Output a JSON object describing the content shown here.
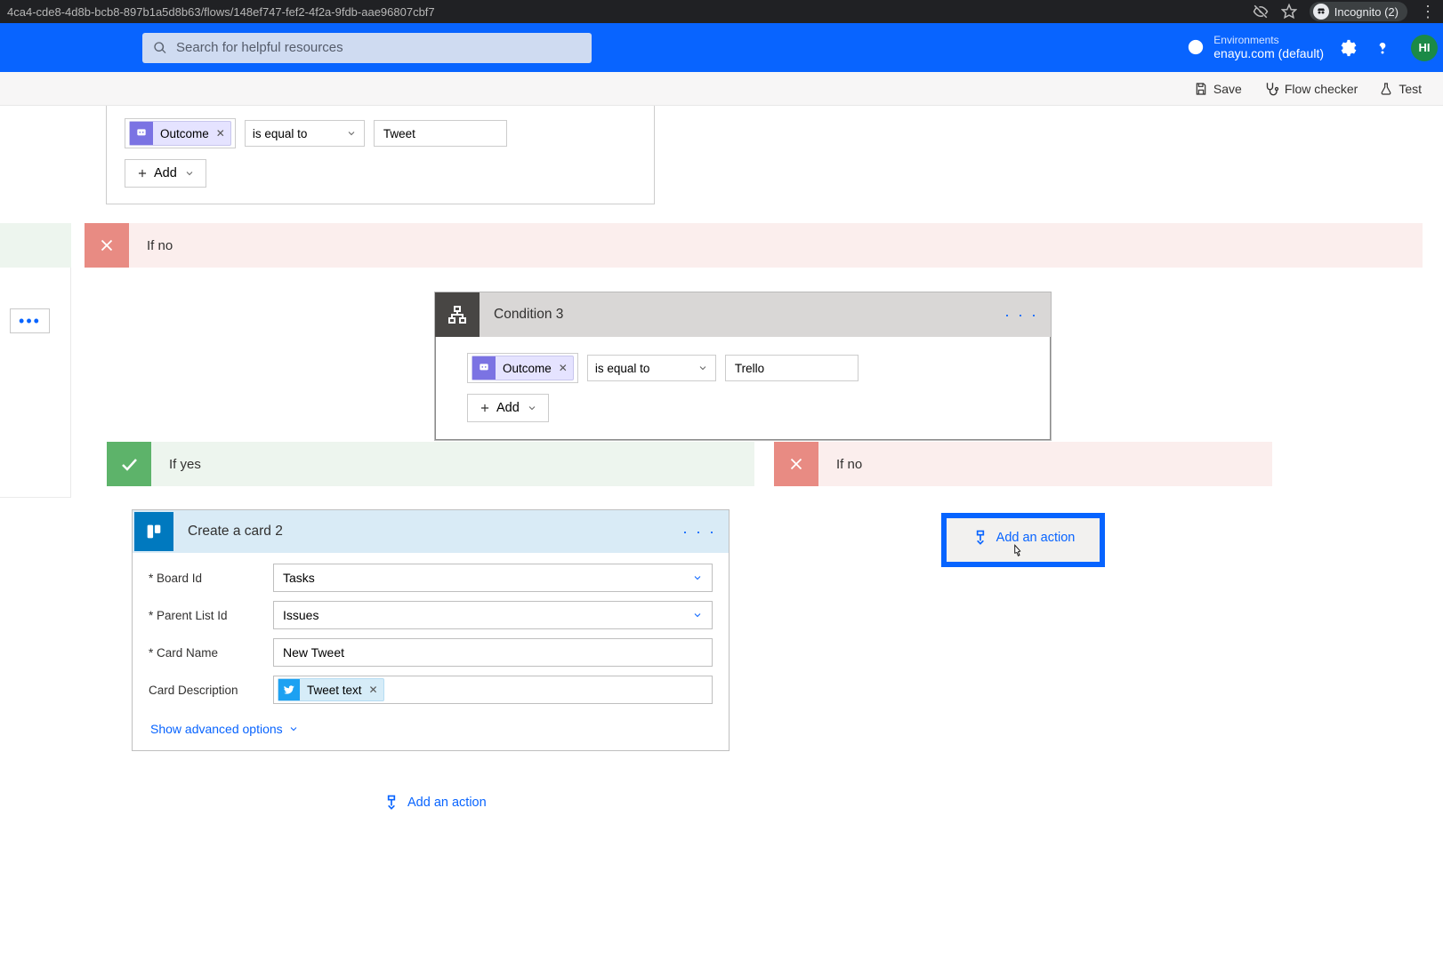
{
  "browser": {
    "url": "4ca4-cde8-4d8b-bcb8-897b1a5d8b63/flows/148ef747-fef2-4f2a-9fdb-aae96807cbf7",
    "incognito_label": "Incognito (2)"
  },
  "header": {
    "search_placeholder": "Search for helpful resources",
    "env_label": "Environments",
    "env_value": "enayu.com (default)",
    "avatar_initials": "HI"
  },
  "toolbar": {
    "save": "Save",
    "flow_checker": "Flow checker",
    "test": "Test"
  },
  "condition_top": {
    "token_label": "Outcome",
    "operator": "is equal to",
    "value": "Tweet",
    "add_label": "Add"
  },
  "branch_labels": {
    "if_no": "If no",
    "if_yes": "If yes"
  },
  "condition3": {
    "title": "Condition 3",
    "token_label": "Outcome",
    "operator": "is equal to",
    "value": "Trello",
    "add_label": "Add"
  },
  "trello_action": {
    "title": "Create a card 2",
    "fields": {
      "board_id": {
        "label": "* Board Id",
        "value": "Tasks"
      },
      "parent_list_id": {
        "label": "* Parent List Id",
        "value": "Issues"
      },
      "card_name": {
        "label": "* Card Name",
        "value": "New Tweet"
      },
      "card_description": {
        "label": "Card Description",
        "token": "Tweet text"
      }
    },
    "advanced_label": "Show advanced options"
  },
  "actions": {
    "add_action": "Add an action"
  },
  "ellipsis": "…"
}
